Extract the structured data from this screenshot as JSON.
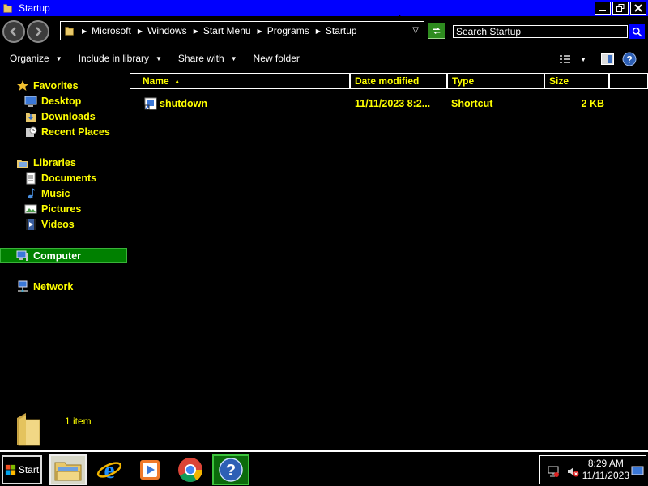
{
  "window": {
    "title": "Startup",
    "controls": [
      "minimize",
      "restore",
      "close"
    ]
  },
  "address": {
    "crumbs": [
      "Microsoft",
      "Windows",
      "Start Menu",
      "Programs",
      "Startup"
    ]
  },
  "search": {
    "placeholder": "Search Startup"
  },
  "toolbar": {
    "organize": "Organize",
    "include_in_library": "Include in library",
    "share_with": "Share with",
    "new_folder": "New folder"
  },
  "nav": {
    "favorites": "Favorites",
    "desktop": "Desktop",
    "downloads": "Downloads",
    "recent_places": "Recent Places",
    "libraries": "Libraries",
    "documents": "Documents",
    "music": "Music",
    "pictures": "Pictures",
    "videos": "Videos",
    "computer": "Computer",
    "network": "Network"
  },
  "columns": {
    "name": "Name",
    "date_modified": "Date modified",
    "type": "Type",
    "size": "Size"
  },
  "files": [
    {
      "name": "shutdown",
      "date_modified": "11/11/2023 8:2...",
      "type": "Shortcut",
      "size": "2 KB"
    }
  ],
  "details": {
    "item_count": "1 item"
  },
  "taskbar": {
    "start_label": "Start",
    "time": "8:29 AM",
    "date": "11/11/2023"
  },
  "colors": {
    "title_bar": "#0000ff",
    "text_highlight": "#ffff00",
    "selection": "#008000"
  }
}
